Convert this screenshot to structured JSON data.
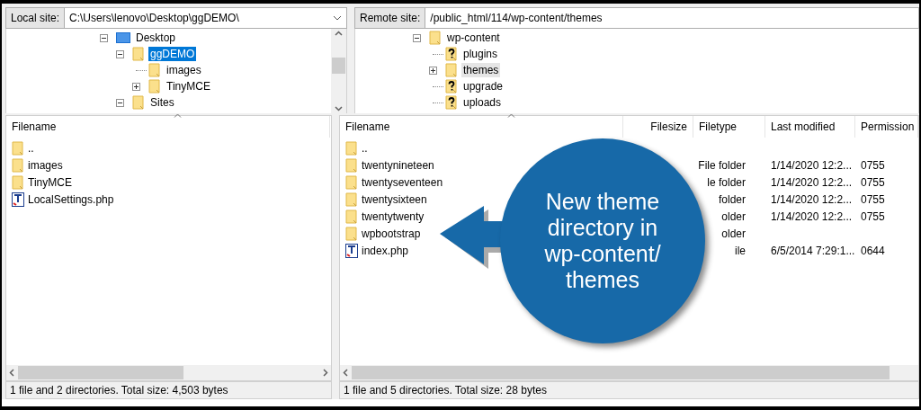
{
  "local": {
    "site_label": "Local site:",
    "path": "C:\\Users\\lenovo\\Desktop\\ggDEMO\\",
    "tree": [
      {
        "label": "Desktop",
        "kind": "desktop",
        "expanded": true,
        "selected": false,
        "children": [
          {
            "label": "ggDEMO",
            "kind": "folder",
            "expanded": true,
            "selected": true,
            "children": [
              {
                "label": "images",
                "kind": "folder",
                "selected": false
              },
              {
                "label": "TinyMCE",
                "kind": "folder",
                "expanded": false,
                "selected": false
              }
            ]
          },
          {
            "label": "Sites",
            "kind": "folder",
            "expanded": true,
            "selected": false
          }
        ]
      }
    ],
    "columns": [
      "Filename"
    ],
    "rows": [
      {
        "kind": "folder",
        "cells": [
          ".."
        ]
      },
      {
        "kind": "folder",
        "cells": [
          "images"
        ]
      },
      {
        "kind": "folder",
        "cells": [
          "TinyMCE"
        ]
      },
      {
        "kind": "php",
        "cells": [
          "LocalSettings.php"
        ]
      }
    ],
    "status": "1 file and 2 directories. Total size: 4,503 bytes"
  },
  "remote": {
    "site_label": "Remote site:",
    "path": "/public_html/114/wp-content/themes",
    "tree": [
      {
        "label": "wp-content",
        "kind": "folder",
        "expanded": true,
        "selected": false,
        "children": [
          {
            "label": "plugins",
            "kind": "unknown",
            "selected": false
          },
          {
            "label": "themes",
            "kind": "folder",
            "expanded": false,
            "selected": true
          },
          {
            "label": "upgrade",
            "kind": "unknown",
            "selected": false
          },
          {
            "label": "uploads",
            "kind": "unknown",
            "selected": false
          }
        ]
      }
    ],
    "columns": [
      "Filename",
      "Filesize",
      "Filetype",
      "Last modified",
      "Permission"
    ],
    "rows": [
      {
        "kind": "folder",
        "cells": [
          "..",
          "",
          "",
          "",
          ""
        ]
      },
      {
        "kind": "folder",
        "cells": [
          "twentynineteen",
          "",
          "File folder",
          "1/14/2020 12:2...",
          "0755"
        ]
      },
      {
        "kind": "folder",
        "cells": [
          "twentyseventeen",
          "",
          "le folder",
          "1/14/2020 12:2...",
          "0755"
        ]
      },
      {
        "kind": "folder",
        "cells": [
          "twentysixteen",
          "",
          "folder",
          "1/14/2020 12:2...",
          "0755"
        ]
      },
      {
        "kind": "folder",
        "cells": [
          "twentytwenty",
          "",
          "older",
          "1/14/2020 12:2...",
          "0755"
        ]
      },
      {
        "kind": "folder",
        "cells": [
          "wpbootstrap",
          "",
          "older",
          "",
          ""
        ]
      },
      {
        "kind": "php",
        "cells": [
          "index.php",
          "",
          "ile",
          "6/5/2014 7:29:1...",
          "0644"
        ]
      }
    ],
    "status": "1 file and 5 directories. Total size: 28 bytes"
  },
  "callout": {
    "text": "New theme directory in wp-content/ themes"
  }
}
